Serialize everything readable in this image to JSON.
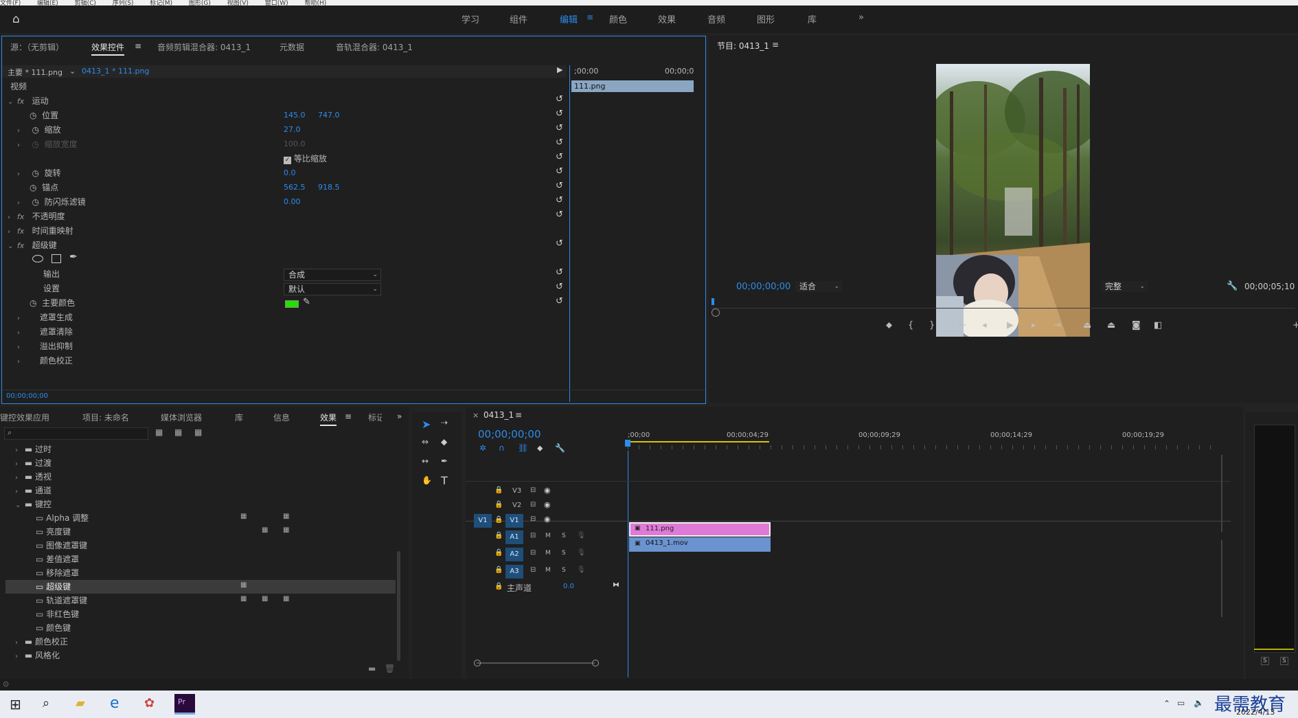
{
  "menubar": {
    "items": [
      "文件(F)",
      "编辑(E)",
      "剪辑(C)",
      "序列(S)",
      "标记(M)",
      "图形(G)",
      "视图(V)",
      "窗口(W)",
      "帮助(H)"
    ]
  },
  "workspace": {
    "tabs": [
      "学习",
      "组件",
      "编辑",
      "颜色",
      "效果",
      "音频",
      "图形",
      "库"
    ],
    "active": "编辑",
    "more": "»"
  },
  "effect_panel": {
    "tabs": [
      "源：（无剪辑）",
      "效果控件",
      "音频剪辑混合器: 0413_1",
      "元数据",
      "音轨混合器: 0413_1"
    ],
    "master": "主要 * 111.png",
    "clip": "0413_1 * 111.png",
    "ruler_start": ";00;00",
    "ruler_end": "00;00;0",
    "clip_bar": "111.png",
    "section_video": "视频",
    "rows": [
      {
        "label": "运动",
        "type": "fx"
      },
      {
        "label": "位置",
        "v1": "145.0",
        "v2": "747.0"
      },
      {
        "label": "缩放",
        "v1": "27.0"
      },
      {
        "label": "缩放宽度",
        "v1": "100.0",
        "dim": true
      },
      {
        "label": "",
        "checkbox": "等比缩放"
      },
      {
        "label": "旋转",
        "v1": "0.0"
      },
      {
        "label": "锚点",
        "v1": "562.5",
        "v2": "918.5"
      },
      {
        "label": "防闪烁滤镜",
        "v1": "0.00"
      },
      {
        "label": "不透明度",
        "type": "fx"
      },
      {
        "label": "时间重映射",
        "type": "fx"
      },
      {
        "label": "超级键",
        "type": "fx"
      }
    ],
    "output_label": "输出",
    "output_value": "合成",
    "settings_label": "设置",
    "settings_value": "默认",
    "key_color_label": "主要颜色",
    "key_color": "#22e000",
    "sub_items": [
      "遮罩生成",
      "遮罩清除",
      "溢出抑制",
      "颜色校正"
    ],
    "timecode": "00;00;00;00"
  },
  "program": {
    "title": "节目: 0413_1",
    "timecode": "00;00;00;00",
    "fit": "适合",
    "quality": "完整",
    "duration": "00;00;05;10"
  },
  "effects_panel": {
    "tabs": [
      "键控效果应用",
      "项目: 未命名",
      "媒体浏览器",
      "库",
      "信息",
      "效果",
      "标记"
    ],
    "active": "效果",
    "tree": [
      {
        "label": "过时",
        "level": 0,
        "folder": true
      },
      {
        "label": "过渡",
        "level": 0,
        "folder": true
      },
      {
        "label": "透视",
        "level": 0,
        "folder": true
      },
      {
        "label": "通道",
        "level": 0,
        "folder": true
      },
      {
        "label": "键控",
        "level": 0,
        "folder": true,
        "open": true
      },
      {
        "label": "Alpha 调整",
        "level": 1
      },
      {
        "label": "亮度键",
        "level": 1
      },
      {
        "label": "图像遮罩键",
        "level": 1
      },
      {
        "label": "差值遮罩",
        "level": 1
      },
      {
        "label": "移除遮罩",
        "level": 1
      },
      {
        "label": "超级键",
        "level": 1,
        "selected": true
      },
      {
        "label": "轨道遮罩键",
        "level": 1
      },
      {
        "label": "非红色键",
        "level": 1
      },
      {
        "label": "颜色键",
        "level": 1
      },
      {
        "label": "颜色校正",
        "level": 0,
        "folder": true
      },
      {
        "label": "风格化",
        "level": 0,
        "folder": true
      }
    ]
  },
  "timeline": {
    "title": "0413_1",
    "timecode": "00;00;00;00",
    "ruler": [
      ";00;00",
      "00;00;04;29",
      "00;00;09;29",
      "00;00;14;29",
      "00;00;19;29"
    ],
    "tracks": [
      "V3",
      "V2",
      "V1",
      "A1",
      "A2",
      "A3"
    ],
    "source_v1": "V1",
    "master_label": "主声道",
    "master_value": "0.0",
    "clip_v2": "111.png",
    "clip_v1": "0413_1.mov",
    "clip_v2_color": "#e07ad8",
    "clip_v1_color": "#6a93d0",
    "mute": "M",
    "solo": "S"
  },
  "meter": {
    "s1": "S",
    "s2": "S"
  },
  "taskbar": {
    "watermark": "最需教育",
    "date": "2022/4/13"
  }
}
